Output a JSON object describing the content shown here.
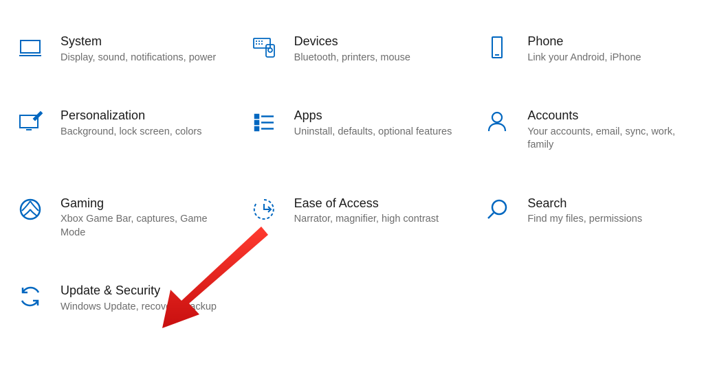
{
  "accent": "#0067c0",
  "items": [
    {
      "key": "system",
      "title": "System",
      "desc": "Display, sound, notifications, power"
    },
    {
      "key": "devices",
      "title": "Devices",
      "desc": "Bluetooth, printers, mouse"
    },
    {
      "key": "phone",
      "title": "Phone",
      "desc": "Link your Android, iPhone"
    },
    {
      "key": "personalization",
      "title": "Personalization",
      "desc": "Background, lock screen, colors"
    },
    {
      "key": "apps",
      "title": "Apps",
      "desc": "Uninstall, defaults, optional features"
    },
    {
      "key": "accounts",
      "title": "Accounts",
      "desc": "Your accounts, email, sync, work, family"
    },
    {
      "key": "gaming",
      "title": "Gaming",
      "desc": "Xbox Game Bar, captures, Game Mode"
    },
    {
      "key": "ease-of-access",
      "title": "Ease of Access",
      "desc": "Narrator, magnifier, high contrast"
    },
    {
      "key": "search",
      "title": "Search",
      "desc": "Find my files, permissions"
    },
    {
      "key": "update-security",
      "title": "Update & Security",
      "desc": "Windows Update, recovery, backup"
    }
  ]
}
